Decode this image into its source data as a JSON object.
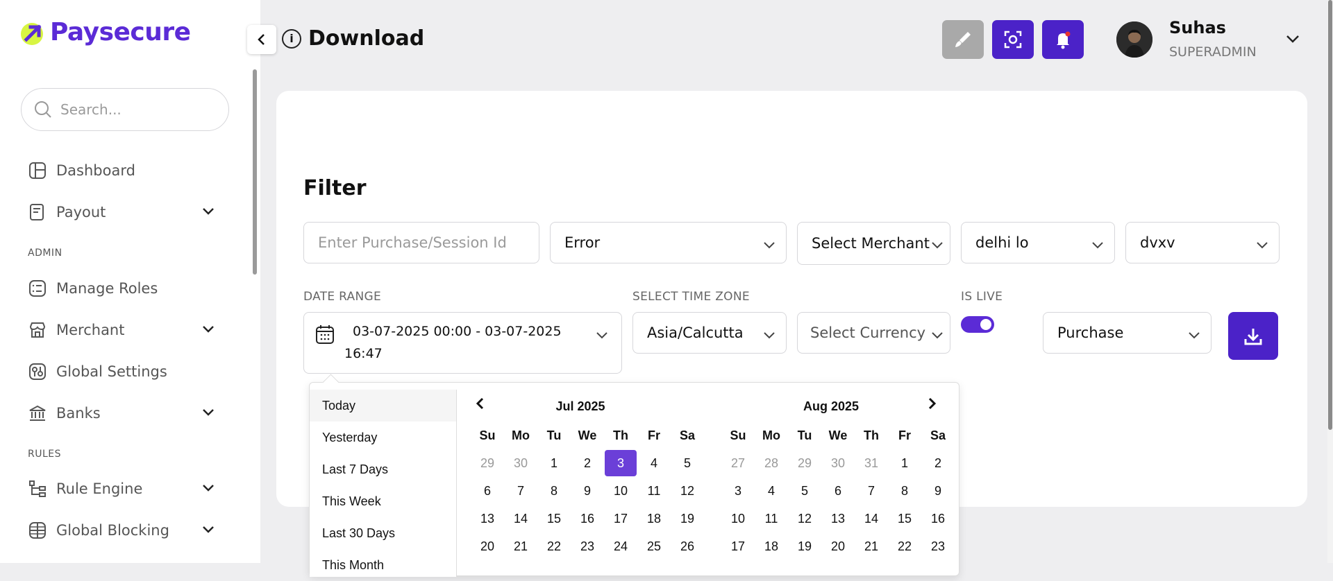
{
  "app": {
    "brand": "Paysecure",
    "accent": "#5b2bd6"
  },
  "sidebar": {
    "search_placeholder": "Search...",
    "items": [
      {
        "label": "Dashboard",
        "icon": "dashboard-icon"
      },
      {
        "label": "Payout",
        "icon": "payout-icon"
      },
      {
        "label": "Manage Roles",
        "icon": "roles-icon"
      },
      {
        "label": "Merchant",
        "icon": "merchant-icon"
      },
      {
        "label": "Global Settings",
        "icon": "settings-icon"
      },
      {
        "label": "Banks",
        "icon": "bank-icon"
      },
      {
        "label": "Rule Engine",
        "icon": "rule-engine-icon"
      },
      {
        "label": "Global Blocking",
        "icon": "globe-icon"
      }
    ],
    "sections": {
      "admin": "ADMIN",
      "rules": "RULES"
    }
  },
  "header": {
    "title": "Download",
    "user": {
      "name": "Suhas",
      "role": "SUPERADMIN"
    }
  },
  "filter": {
    "title": "Filter",
    "purchase_placeholder": "Enter Purchase/Session Id",
    "status": "Error",
    "merchant": "Select Merchant",
    "field3": "delhi lo",
    "field4": "dvxv",
    "date_range_label": "DATE RANGE",
    "date_range_line1": "03-07-2025 00:00 - 03-07-2025",
    "date_range_line2": "16:47",
    "timezone_label": "SELECT TIME ZONE",
    "timezone": "Asia/Calcutta",
    "currency": "Select Currency",
    "is_live_label": "IS LIVE",
    "is_live": true,
    "type": "Purchase"
  },
  "picker": {
    "ranges": [
      "Today",
      "Yesterday",
      "Last 7 Days",
      "This Week",
      "Last 30 Days",
      "This Month"
    ],
    "days_of_week": [
      "Su",
      "Mo",
      "Tu",
      "We",
      "Th",
      "Fr",
      "Sa"
    ],
    "left_month": {
      "title": "Jul 2025",
      "days": [
        [
          "29",
          "30",
          "1",
          "2",
          "3",
          "4",
          "5"
        ],
        [
          "6",
          "7",
          "8",
          "9",
          "10",
          "11",
          "12"
        ],
        [
          "13",
          "14",
          "15",
          "16",
          "17",
          "18",
          "19"
        ],
        [
          "20",
          "21",
          "22",
          "23",
          "24",
          "25",
          "26"
        ]
      ],
      "off_days_first_row": 2,
      "selected": "3"
    },
    "right_month": {
      "title": "Aug 2025",
      "days": [
        [
          "27",
          "28",
          "29",
          "30",
          "31",
          "1",
          "2"
        ],
        [
          "3",
          "4",
          "5",
          "6",
          "7",
          "8",
          "9"
        ],
        [
          "10",
          "11",
          "12",
          "13",
          "14",
          "15",
          "16"
        ],
        [
          "17",
          "18",
          "19",
          "20",
          "21",
          "22",
          "23"
        ]
      ],
      "off_days_first_row": 5
    }
  }
}
